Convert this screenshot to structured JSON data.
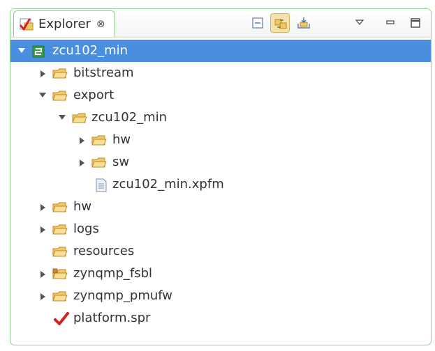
{
  "explorer": {
    "tab_label": "Explorer",
    "tab_close_glyph": "⊗",
    "toolbar_icons": [
      "collapse-all-icon",
      "link-with-editor-icon",
      "import-icon",
      "view-menu-icon",
      "minimize-icon",
      "maximize-icon"
    ]
  },
  "tree": {
    "root": "zcu102_min",
    "bitstream": "bitstream",
    "export": "export",
    "export_zcu102_min": "zcu102_min",
    "export_hw": "hw",
    "export_sw": "sw",
    "xpfm_file": "zcu102_min.xpfm",
    "hw": "hw",
    "logs": "logs",
    "resources": "resources",
    "zynqmp_fsbl": "zynqmp_fsbl",
    "zynqmp_pmufw": "zynqmp_pmufw",
    "platform_spr": "platform.spr"
  },
  "colors": {
    "accent_border": "#8fd28d",
    "selection": "#4a8ee0",
    "folder": "#f2c766"
  }
}
